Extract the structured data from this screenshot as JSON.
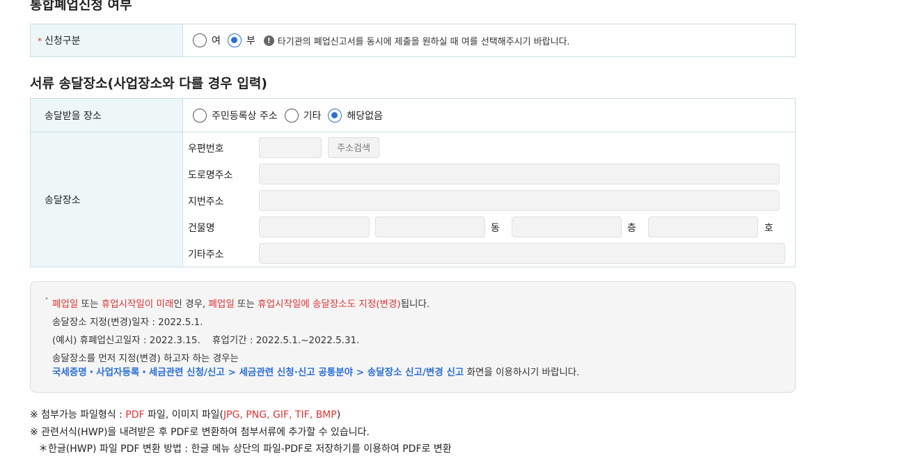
{
  "section1": {
    "title": "통합폐업신청 여부",
    "required_mark": "*",
    "label": "신청구분",
    "options": [
      "여",
      "부"
    ],
    "selected": "부",
    "info_text": "타기관의 폐업신고서를 동시에 제출을 원하실 때 여를 선택해주시기 바랍니다."
  },
  "section2": {
    "title": "서류 송달장소(사업장소와 다를 경우 입력)",
    "place_label": "송달받을 장소",
    "place_options": [
      "주민등록상 주소",
      "기타",
      "해당없음"
    ],
    "place_selected": "해당없음",
    "address_label": "송달장소",
    "zip_label": "우편번호",
    "search_button": "주소검색",
    "road_label": "도로명주소",
    "lot_label": "지번주소",
    "building_label": "건물명",
    "dong_unit": "동",
    "floor_unit": "층",
    "ho_unit": "호",
    "etc_label": "기타주소"
  },
  "notice": {
    "line1": {
      "p1": "폐업일",
      "p2": " 또는 ",
      "p3": "휴업시작일이 미래",
      "p4": "인 경우, ",
      "p5": "폐업일",
      "p6": " 또는 ",
      "p7": "휴업시작일에 송달장소도 지정(변경)",
      "p8": "됩니다."
    },
    "line2": "송달장소 지정(변경)일자 : 2022.5.1.",
    "line3": "(예시) 휴폐업신고일자 : 2022.3.15.    휴업기간 : 2022.5.1.~2022.5.31.",
    "line4": "송달장소를 먼저 지정(변경) 하고자 하는 경우는",
    "line5_link": "국세증명・사업자등록・세금관련 신청/신고 > 세금관련 신청·신고 공통분야 > 송달장소 신고/변경 신고",
    "line5_rest": " 화면을 이용하시기 바랍니다."
  },
  "footer": {
    "line1_prefix": "※ 첨부가능 파일형식 : ",
    "line1_pdf": "PDF",
    "line1_mid": " 파일, 이미지 파일(",
    "line1_images": "JPG, PNG, GIF, TIF, BMP",
    "line1_end": ")",
    "line2": "※ 관련서식(HWP)을 내려받은 후 PDF로 변환하여 첨부서류에 추가할 수 있습니다.",
    "line3": "＊한글(HWP) 파일 PDF 변환 방법 : 한글 메뉴 상단의 파일-PDF로 저장하기를 이용하여 PDF로 변환"
  },
  "colors": {
    "accent": "#2b6fd6",
    "highlight_red": "#e03131",
    "header_bg": "#edf7f7"
  }
}
